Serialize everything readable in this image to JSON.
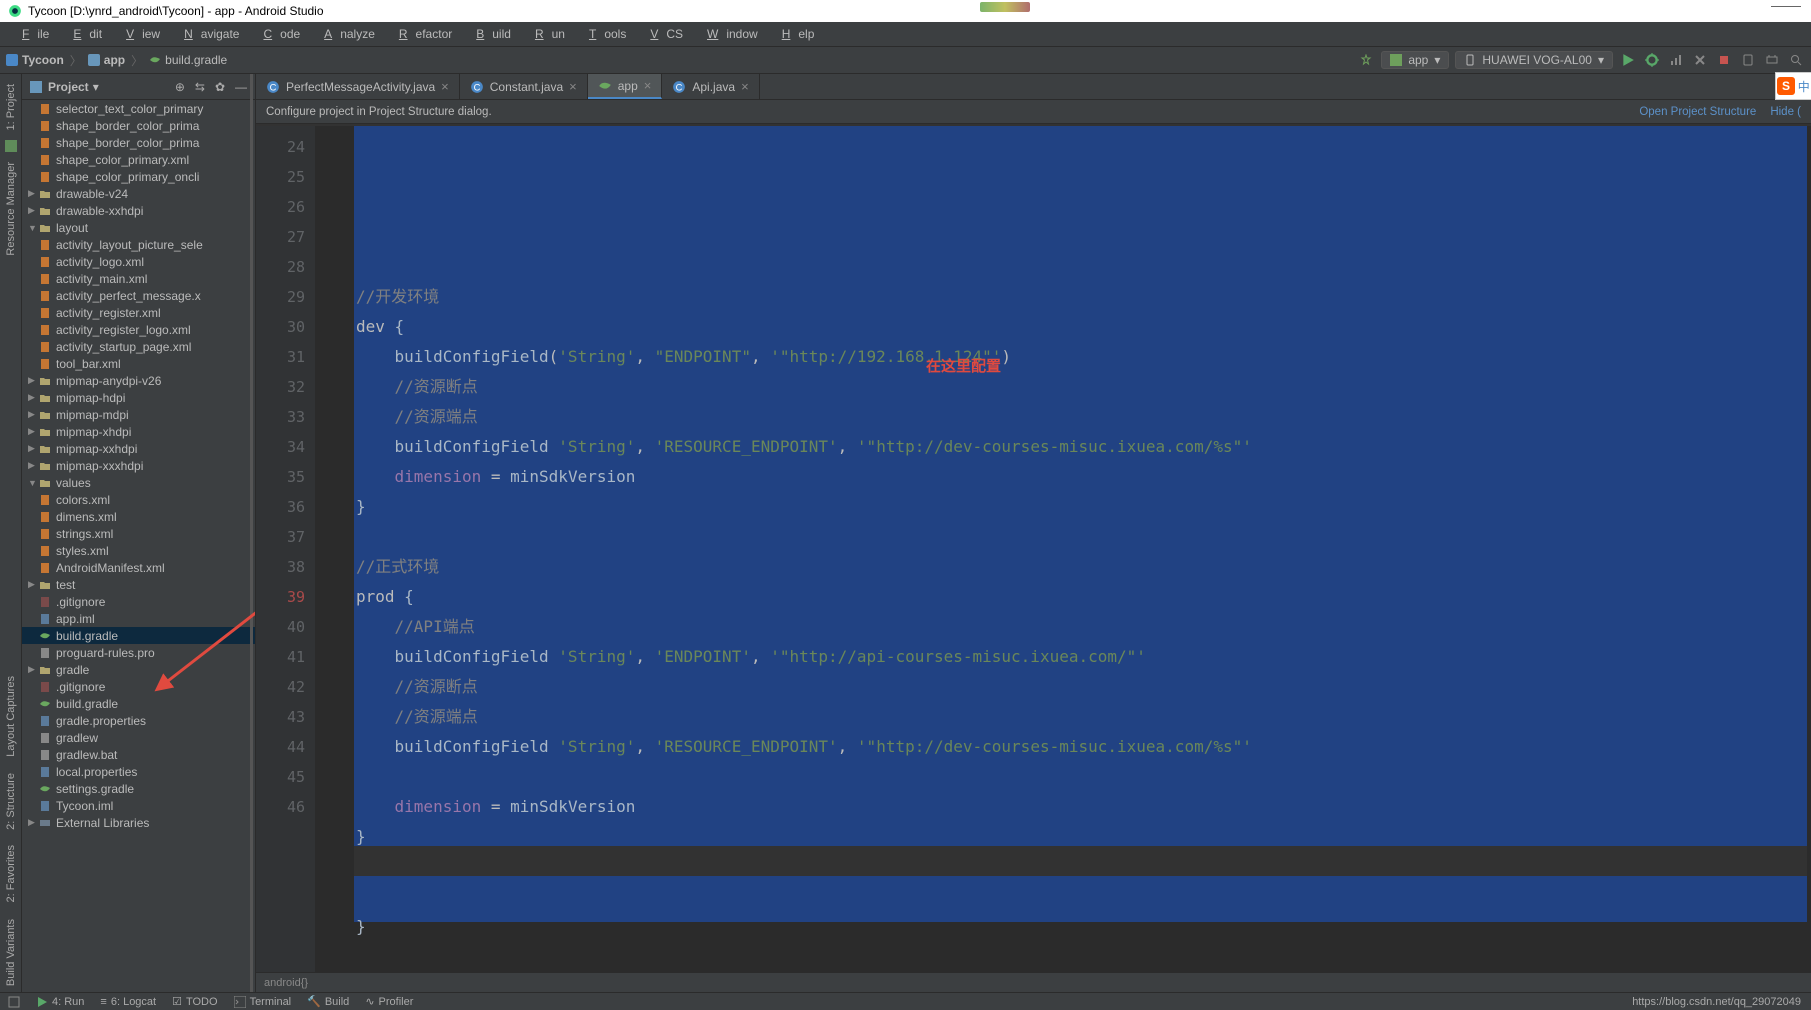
{
  "window_title": "Tycoon [D:\\ynrd_android\\Tycoon] - app - Android Studio",
  "menu": [
    "File",
    "Edit",
    "View",
    "Navigate",
    "Code",
    "Analyze",
    "Refactor",
    "Build",
    "Run",
    "Tools",
    "VCS",
    "Window",
    "Help"
  ],
  "breadcrumb": {
    "root": "Tycoon",
    "module": "app",
    "file": "build.gradle"
  },
  "run_config": {
    "module": "app",
    "device": "HUAWEI VOG-AL00"
  },
  "project_header": "Project",
  "tree": [
    {
      "t": "file",
      "lvl": 5,
      "icon": "xml",
      "label": "selector_text_color_primary"
    },
    {
      "t": "file",
      "lvl": 5,
      "icon": "xml",
      "label": "shape_border_color_prima"
    },
    {
      "t": "file",
      "lvl": 5,
      "icon": "xml",
      "label": "shape_border_color_prima"
    },
    {
      "t": "file",
      "lvl": 5,
      "icon": "xml",
      "label": "shape_color_primary.xml"
    },
    {
      "t": "file",
      "lvl": 5,
      "icon": "xml",
      "label": "shape_color_primary_oncli"
    },
    {
      "t": "fold",
      "lvl": 3,
      "arrow": "▶",
      "icon": "fld",
      "label": "drawable-v24"
    },
    {
      "t": "fold",
      "lvl": 3,
      "arrow": "▶",
      "icon": "fld",
      "label": "drawable-xxhdpi"
    },
    {
      "t": "fold",
      "lvl": 3,
      "arrow": "▼",
      "icon": "fld",
      "label": "layout"
    },
    {
      "t": "file",
      "lvl": 5,
      "icon": "xml",
      "label": "activity_layout_picture_sele"
    },
    {
      "t": "file",
      "lvl": 5,
      "icon": "xml",
      "label": "activity_logo.xml"
    },
    {
      "t": "file",
      "lvl": 5,
      "icon": "xml",
      "label": "activity_main.xml"
    },
    {
      "t": "file",
      "lvl": 5,
      "icon": "xml",
      "label": "activity_perfect_message.x"
    },
    {
      "t": "file",
      "lvl": 5,
      "icon": "xml",
      "label": "activity_register.xml"
    },
    {
      "t": "file",
      "lvl": 5,
      "icon": "xml",
      "label": "activity_register_logo.xml"
    },
    {
      "t": "file",
      "lvl": 5,
      "icon": "xml",
      "label": "activity_startup_page.xml"
    },
    {
      "t": "file",
      "lvl": 5,
      "icon": "xml",
      "label": "tool_bar.xml"
    },
    {
      "t": "fold",
      "lvl": 3,
      "arrow": "▶",
      "icon": "fld",
      "label": "mipmap-anydpi-v26"
    },
    {
      "t": "fold",
      "lvl": 3,
      "arrow": "▶",
      "icon": "fld",
      "label": "mipmap-hdpi"
    },
    {
      "t": "fold",
      "lvl": 3,
      "arrow": "▶",
      "icon": "fld",
      "label": "mipmap-mdpi"
    },
    {
      "t": "fold",
      "lvl": 3,
      "arrow": "▶",
      "icon": "fld",
      "label": "mipmap-xhdpi"
    },
    {
      "t": "fold",
      "lvl": 3,
      "arrow": "▶",
      "icon": "fld",
      "label": "mipmap-xxhdpi"
    },
    {
      "t": "fold",
      "lvl": 3,
      "arrow": "▶",
      "icon": "fld",
      "label": "mipmap-xxxhdpi"
    },
    {
      "t": "fold",
      "lvl": 3,
      "arrow": "▼",
      "icon": "fld",
      "label": "values"
    },
    {
      "t": "file",
      "lvl": 5,
      "icon": "xml",
      "label": "colors.xml"
    },
    {
      "t": "file",
      "lvl": 5,
      "icon": "xml",
      "label": "dimens.xml"
    },
    {
      "t": "file",
      "lvl": 5,
      "icon": "xml",
      "label": "strings.xml"
    },
    {
      "t": "file",
      "lvl": 5,
      "icon": "xml",
      "label": "styles.xml"
    },
    {
      "t": "file",
      "lvl": 3,
      "icon": "xml",
      "label": "AndroidManifest.xml"
    },
    {
      "t": "fold",
      "lvl": 2,
      "arrow": "▶",
      "icon": "fld",
      "label": "test"
    },
    {
      "t": "file",
      "lvl": 2,
      "icon": "gitc",
      "label": ".gitignore"
    },
    {
      "t": "file",
      "lvl": 2,
      "icon": "propf",
      "label": "app.iml"
    },
    {
      "t": "file",
      "lvl": 2,
      "icon": "grad",
      "label": "build.gradle",
      "sel": true
    },
    {
      "t": "file",
      "lvl": 2,
      "icon": "gen",
      "label": "proguard-rules.pro"
    },
    {
      "t": "fold",
      "lvl": 1,
      "arrow": "▶",
      "icon": "fld",
      "label": "gradle"
    },
    {
      "t": "file",
      "lvl": 1,
      "icon": "gitc",
      "label": ".gitignore"
    },
    {
      "t": "file",
      "lvl": 1,
      "icon": "grad",
      "label": "build.gradle"
    },
    {
      "t": "file",
      "lvl": 1,
      "icon": "propf",
      "label": "gradle.properties"
    },
    {
      "t": "file",
      "lvl": 1,
      "icon": "gen",
      "label": "gradlew"
    },
    {
      "t": "file",
      "lvl": 1,
      "icon": "gen",
      "label": "gradlew.bat"
    },
    {
      "t": "file",
      "lvl": 1,
      "icon": "propf",
      "label": "local.properties"
    },
    {
      "t": "file",
      "lvl": 1,
      "icon": "grad",
      "label": "settings.gradle"
    },
    {
      "t": "file",
      "lvl": 1,
      "icon": "propf",
      "label": "Tycoon.iml"
    },
    {
      "t": "fold",
      "lvl": 0,
      "arrow": "▶",
      "icon": "pyf",
      "label": "External Libraries"
    }
  ],
  "tabs": [
    {
      "label": "PerfectMessageActivity.java",
      "icon": "java"
    },
    {
      "label": "Constant.java",
      "icon": "java"
    },
    {
      "label": "app",
      "icon": "gradle",
      "active": true
    },
    {
      "label": "Api.java",
      "icon": "java"
    }
  ],
  "notif": {
    "text": "Configure project in Project Structure dialog.",
    "link1": "Open Project Structure",
    "link2": "Hide ("
  },
  "gutter": {
    "start": 24,
    "end": 46,
    "bp": [
      39
    ]
  },
  "code_lines": [
    {
      "cmt": "//开发环境"
    },
    {
      "raw": "dev <span class='c-p'>{</span>"
    },
    {
      "raw": "    <span class='c-id'>buildConfigField</span>(<span class='c-str'>'String'</span>, <span class='c-str'>\"ENDPOINT\"</span>, <span class='c-str'>'\"http://192.168.1.124\"'</span>)"
    },
    {
      "cmt": "    //资源断点"
    },
    {
      "cmt": "    //资源端点"
    },
    {
      "raw": "    <span class='c-id'>buildConfigField</span> <span class='c-str'>'String'</span>, <span class='c-str'>'RESOURCE_ENDPOINT'</span>, <span class='c-str'>'\"http://dev-courses-misuc.ixuea.com/%s\"'</span>"
    },
    {
      "raw": "    <span class='c-field'>dimension</span> = <span class='c-id'>minSdkVersion</span>"
    },
    {
      "raw": "<span class='c-p'>}</span>"
    },
    {
      "raw": " "
    },
    {
      "cmt": "//正式环境"
    },
    {
      "raw": "prod <span class='c-p'>{</span>"
    },
    {
      "cmt": "    //API端点"
    },
    {
      "raw": "    <span class='c-id'>buildConfigField</span> <span class='c-str'>'String'</span>, <span class='c-str'>'ENDPOINT'</span>, <span class='c-str'>'\"http://api-courses-misuc.ixuea.com/\"'</span>"
    },
    {
      "cmt": "    //资源断点"
    },
    {
      "cmt": "    //资源端点"
    },
    {
      "raw": "    <span class='c-id'>buildConfigField</span> <span class='c-str'>'String'</span>, <span class='c-str'>'RESOURCE_ENDPOINT'</span>, <span class='c-str'>'\"http://dev-courses-misuc.ixuea.com/%s\"'</span>"
    },
    {
      "raw": " "
    },
    {
      "raw": "    <span class='c-field'>dimension</span> = <span class='c-id'>minSdkVersion</span>"
    },
    {
      "raw": "<span class='c-p'>}</span>"
    },
    {
      "raw": " "
    },
    {
      "raw": " "
    },
    {
      "raw": "<span class='c-p'>}</span>"
    },
    {
      "raw": " "
    }
  ],
  "annotation": "在这里配置",
  "crumb_bar": "android{}",
  "left_rail": [
    "1: Project",
    "Resource Manager",
    "Build Variants",
    "2: Favorites",
    "2: Structure",
    "Layout Captures"
  ],
  "status_tabs": [
    "4: Run",
    "6: Logcat",
    "TODO",
    "Terminal",
    "Build",
    "Profiler"
  ],
  "status_right": "https://blog.csdn.net/qq_29072049"
}
